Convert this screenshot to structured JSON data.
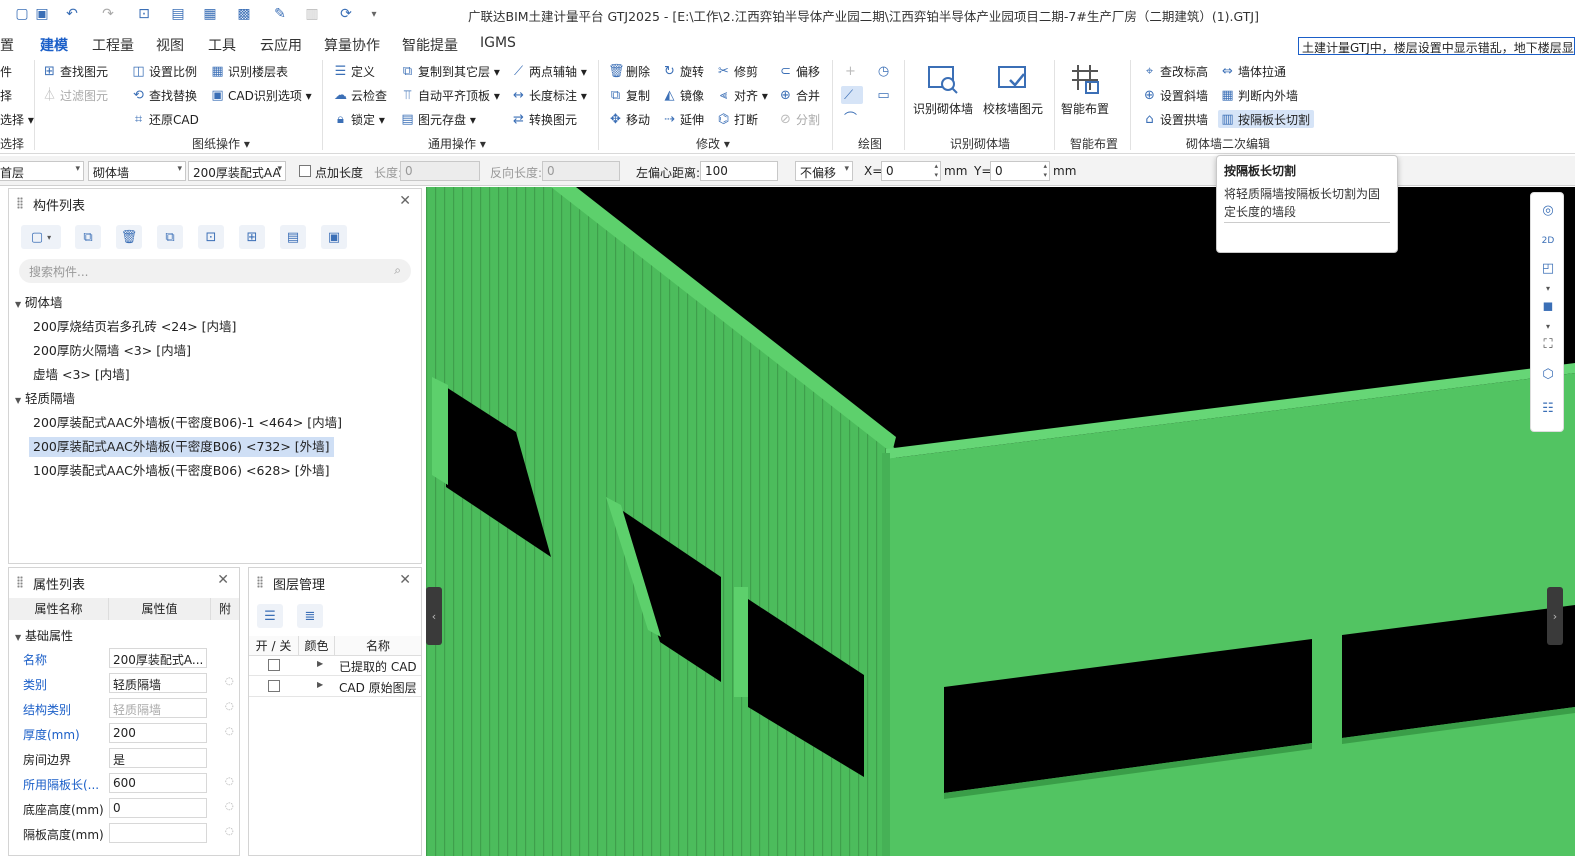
{
  "title": "广联达BIM土建计量平台 GTJ2025 - [E:\\工作\\2.江西弈铂半导体产业园二期\\江西弈铂半导体产业园项目二期-7#生产厂房（二期建筑）(1).GTJ]",
  "menu": [
    "置",
    "建模",
    "工程量",
    "视图",
    "工具",
    "云应用",
    "算量协作",
    "智能提量",
    "IGMS"
  ],
  "help_search_text": "土建计量GTJ中，楼层设置中显示错乱，地下楼层显",
  "ribbon": {
    "col0": [
      "件",
      "择",
      "选择 ▾"
    ],
    "group0_label": "选择",
    "drawing": [
      "查找图元",
      "过滤图元",
      "设置比例",
      "查找替换",
      "还原CAD",
      "识别楼层表",
      "CAD识别选项 ▾"
    ],
    "drawing_label": "图纸操作 ▾",
    "general": [
      "定义",
      "云检查",
      "锁定 ▾",
      "复制到其它层 ▾",
      "自动平齐顶板 ▾",
      "图元存盘 ▾",
      "两点辅轴 ▾",
      "长度标注 ▾",
      "转换图元"
    ],
    "general_label": "通用操作 ▾",
    "modify": [
      "删除",
      "复制",
      "移动",
      "旋转",
      "镜像",
      "延伸",
      "修剪",
      "对齐 ▾",
      "打断",
      "偏移",
      "合并",
      "分割"
    ],
    "modify_label": "修改 ▾",
    "draw_label": "绘图",
    "identify": [
      "识别砌体墙",
      "校核墙图元"
    ],
    "identify_label": "识别砌体墙",
    "smart": [
      "智能布置"
    ],
    "smart_label": "智能布置",
    "second": [
      "查改标高",
      "设置斜墙",
      "设置拱墙",
      "墙体拉通",
      "判断内外墙",
      "按隔板长切割"
    ],
    "second_label": "砌体墙二次编辑"
  },
  "property_toolbar": {
    "floor": "首层",
    "type": "砌体墙",
    "component": "200厚装配式AA",
    "point_length": "点加长度",
    "length_label": "长度:",
    "length_value": "0",
    "reverse_label": "反向长度:",
    "reverse_value": "0",
    "offset_label": "左偏心距离:",
    "offset_value": "100",
    "no_offset": "不偏移",
    "x_label": "X=",
    "x_value": "0",
    "y_label": "Y=",
    "y_value": "0",
    "unit": "mm"
  },
  "component_panel": {
    "title": "构件列表",
    "search_placeholder": "搜索构件...",
    "groups": [
      {
        "name": "砌体墙",
        "items": [
          "200厚烧结页岩多孔砖 <24> [内墙]",
          "200厚防火隔墙 <3> [内墙]",
          "虚墙 <3> [内墙]"
        ]
      },
      {
        "name": "轻质隔墙",
        "items": [
          "200厚装配式AAC外墙板(干密度B06)-1 <464> [内墙]",
          "200厚装配式AAC外墙板(干密度B06) <732> [外墙]",
          "100厚装配式AAC外墙板(干密度B06) <628> [外墙]"
        ]
      }
    ]
  },
  "attributes_panel": {
    "title": "属性列表",
    "col_name": "属性名称",
    "col_value": "属性值",
    "col_extra": "附",
    "section": "基础属性",
    "rows": [
      {
        "name": "名称",
        "value": "200厚装配式A..."
      },
      {
        "name": "类别",
        "value": "轻质隔墙"
      },
      {
        "name": "结构类别",
        "value": "轻质隔墙"
      },
      {
        "name": "厚度(mm)",
        "value": "200"
      },
      {
        "name": "房间边界",
        "value": "是"
      },
      {
        "name": "所用隔板长(...",
        "value": "600"
      },
      {
        "name": "底座高度(mm)",
        "value": "0"
      },
      {
        "name": "隔板高度(mm)",
        "value": ""
      }
    ]
  },
  "layer_panel": {
    "title": "图层管理",
    "col_toggle": "开 / 关",
    "col_color": "颜色",
    "col_name": "名称",
    "rows": [
      "已提取的 CAD",
      "CAD 原始图层"
    ]
  },
  "tooltip": {
    "title": "按隔板长切割",
    "body": "将轻质隔墙按隔板长切割为固定长度的墙段"
  },
  "colors": {
    "accent": "#1b5fc8",
    "wall_green": "#52c462",
    "wall_green_dark": "#3a9e48",
    "viewport_bg": "#000000"
  }
}
